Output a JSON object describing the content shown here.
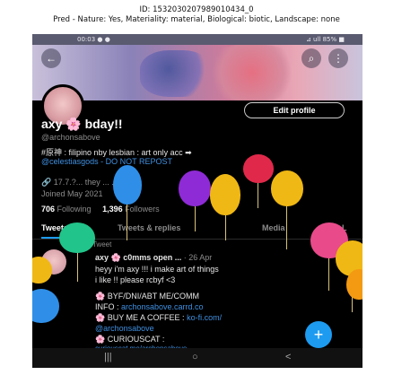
{
  "caption": {
    "line1": "ID: 1532030207989010434_0",
    "line2": "Pred - Nature: Yes, Materiality: material, Biological: biotic, Landscape: none"
  },
  "statusbar": {
    "time": "00:03 ● ●",
    "right": "⊿ ull 85% ■"
  },
  "header": {
    "back_icon": "←",
    "search_icon": "⌕",
    "more_icon": "⋮"
  },
  "profile": {
    "edit_label": "Edit profile",
    "name": "axy 🌸 bday!!",
    "handle": "@archonsabove",
    "bio_line1": "#原神 : filipino nby lesbian : art only acc ➡",
    "bio_line2": "@celestiasgods - DO NOT REPOST",
    "meta_line1": "🔗 17.7.?... they ... ...erday!",
    "meta_line2": "Joined May 2021",
    "following_count": "706",
    "following_label": "Following",
    "followers_count": "1,396",
    "followers_label": "Followers"
  },
  "tabs": [
    "Tweets",
    "Tweets & replies",
    "Media",
    "L"
  ],
  "tweet": {
    "pinned": "Pinned Tweet",
    "header": "axy 🌸 c0mms open ...",
    "date": "· 26 Apr",
    "line1": "heyy i'm axy !!! i make art of things",
    "line2": "i like !! please rcbyf <3",
    "line3": "🌸 BYF/DNI/ABT ME/COMM",
    "line4a": "INFO :",
    "line4b": "archonsabove.carrd.co",
    "line5a": "🌸 BUY ME A COFFEE :",
    "line5b": "ko-fi.com/",
    "line6": "@archonsabove",
    "line7": "🌸 CURIOUSCAT :",
    "line8": "curiouscat.me/archonsabove"
  },
  "fab_icon": "+",
  "bottombar": {
    "recents": "|||",
    "home": "○",
    "back": "<"
  },
  "balloon_colors": {
    "blue": "#2f8fe8",
    "purple": "#8e2bd6",
    "red": "#e0294a",
    "gold": "#f0b814",
    "green": "#21c48a",
    "orange": "#f39a12",
    "pink": "#e94a8a"
  }
}
